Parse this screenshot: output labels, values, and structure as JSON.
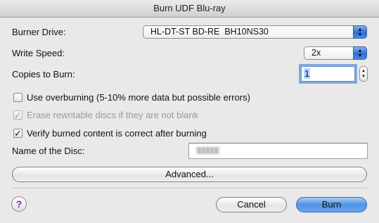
{
  "window": {
    "title": "Burn UDF Blu-ray"
  },
  "burner": {
    "label": "Burner Drive:",
    "value": "HL-DT-ST BD-RE  BH10NS30"
  },
  "speed": {
    "label": "Write Speed:",
    "value": "2x"
  },
  "copies": {
    "label": "Copies to Burn:",
    "value": "1"
  },
  "options": {
    "overburn": {
      "label": "Use overburning (5-10% more data but possible errors)",
      "checked": false,
      "enabled": true
    },
    "erase": {
      "label": "Erase rewritable discs if they are not blank",
      "checked": true,
      "enabled": false
    },
    "verify": {
      "label": "Verify burned content is correct after burning",
      "checked": true,
      "enabled": true
    }
  },
  "disc_name": {
    "label": "Name of the Disc:",
    "value": ""
  },
  "buttons": {
    "advanced": "Advanced...",
    "cancel": "Cancel",
    "burn": "Burn",
    "help": "?"
  },
  "icons": {
    "popup": "up-down-arrows-icon",
    "stepper": "stepper-arrows-icon",
    "checkmark": "checkmark-icon"
  },
  "colors": {
    "accent": "#3b7fe0",
    "focus_ring": "#7fa9e0",
    "help_glyph": "#7a2bb0"
  }
}
